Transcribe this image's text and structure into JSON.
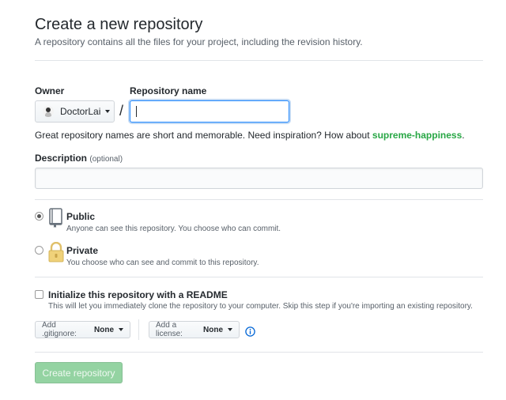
{
  "header": {
    "title": "Create a new repository",
    "subtitle": "A repository contains all the files for your project, including the revision history."
  },
  "owner": {
    "label": "Owner",
    "value": "DoctorLai"
  },
  "separator": "/",
  "repo_name": {
    "label": "Repository name",
    "value": ""
  },
  "name_hint": {
    "text": "Great repository names are short and memorable. Need inspiration? How about ",
    "suggestion": "supreme-happiness",
    "suffix": "."
  },
  "description": {
    "label": "Description",
    "optional": "(optional)",
    "value": ""
  },
  "visibility": {
    "selected": "public",
    "options": [
      {
        "id": "public",
        "title": "Public",
        "note": "Anyone can see this repository. You choose who can commit."
      },
      {
        "id": "private",
        "title": "Private",
        "note": "You choose who can see and commit to this repository."
      }
    ]
  },
  "readme": {
    "checked": false,
    "title": "Initialize this repository with a README",
    "note": "This will let you immediately clone the repository to your computer. Skip this step if you're importing an existing repository."
  },
  "gitignore": {
    "prefix": "Add .gitignore:",
    "value": "None"
  },
  "license": {
    "prefix": "Add a license:",
    "value": "None"
  },
  "submit": {
    "label": "Create repository",
    "enabled": false
  },
  "colors": {
    "suggestion": "#28a745",
    "create_disabled": "#94d3a2",
    "input_focus": "#2188ff",
    "info": "#0366d6"
  },
  "icons": {
    "public": "repo-book-icon",
    "private": "lock-icon",
    "info": "info-icon",
    "owner": "avatar"
  }
}
